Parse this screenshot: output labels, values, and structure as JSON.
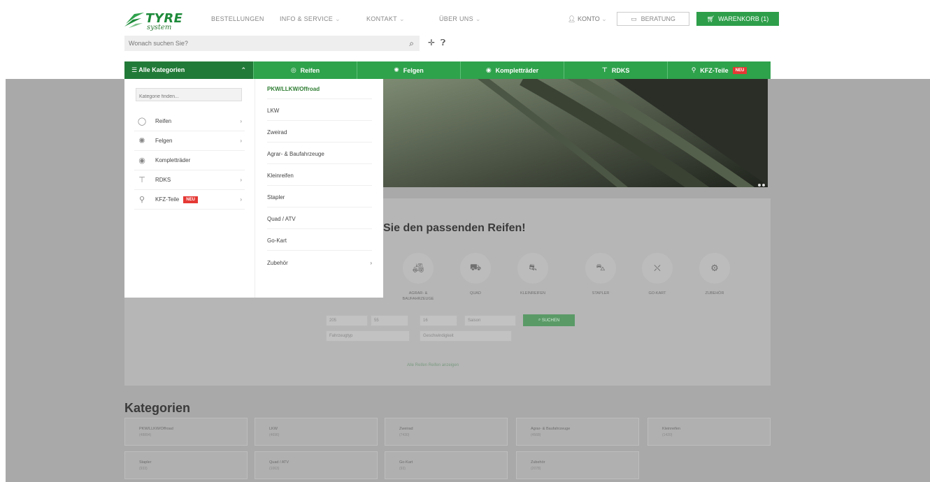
{
  "brand": {
    "name": "TYRE",
    "sub": "system",
    "green": "#2fa24c",
    "dark_green": "#227a38"
  },
  "topnav": [
    {
      "label": "BESTELLUNGEN",
      "chev": false
    },
    {
      "label": "INFO & SERVICE",
      "chev": true
    },
    {
      "label": "KONTAKT",
      "chev": true
    },
    {
      "label": "ÜBER UNS",
      "chev": true
    }
  ],
  "account": {
    "konto": "KONTO",
    "beratung": "BERATUNG",
    "cart": "WARENKORB (1)"
  },
  "search": {
    "placeholder": "Wonach suchen Sie?"
  },
  "greennav": {
    "all": "Alle Kategorien",
    "items": [
      {
        "label": "Reifen",
        "icon": "tire-icon"
      },
      {
        "label": "Felgen",
        "icon": "rim-icon"
      },
      {
        "label": "Kompletträder",
        "icon": "wheel-icon"
      },
      {
        "label": "RDKS",
        "icon": "sensor-icon"
      },
      {
        "label": "KFZ-Teile",
        "icon": "parts-icon",
        "badge": "NEU"
      }
    ]
  },
  "dropdown": {
    "search_placeholder": "Kategorie finden...",
    "left": [
      {
        "label": "Reifen",
        "arrow": true
      },
      {
        "label": "Felgen",
        "arrow": true
      },
      {
        "label": "Kompletträder",
        "arrow": false
      },
      {
        "label": "RDKS",
        "arrow": true
      },
      {
        "label": "KFZ-Teile",
        "arrow": true,
        "badge": "NEU"
      }
    ],
    "right": [
      {
        "label": "PKW/LLKW/Offroad",
        "arrow": false
      },
      {
        "label": "LKW",
        "arrow": false
      },
      {
        "label": "Zweirad",
        "arrow": false
      },
      {
        "label": "Agrar- & Baufahrzeuge",
        "arrow": false
      },
      {
        "label": "Kleinreifen",
        "arrow": false
      },
      {
        "label": "Stapler",
        "arrow": false
      },
      {
        "label": "Quad / ATV",
        "arrow": false
      },
      {
        "label": "Go-Kart",
        "arrow": false
      },
      {
        "label": "Zubehör",
        "arrow": true
      }
    ]
  },
  "finder": {
    "title": "Sie den passenden Reifen!",
    "vehicles": [
      {
        "label": "AGRAR- &\nBAUFAHRZEUGE",
        "icon": "tractor-icon"
      },
      {
        "label": "QUAD",
        "icon": "quad-icon"
      },
      {
        "label": "KLEINREIFEN",
        "icon": "smalltire-icon"
      },
      {
        "label": "STAPLER",
        "icon": "forklift-icon"
      },
      {
        "label": "GO-KART",
        "icon": "gokart-icon"
      },
      {
        "label": "ZUBEHÖR",
        "icon": "accessory-icon"
      }
    ],
    "selects": [
      "205",
      "55",
      "16",
      "Saison"
    ],
    "selects2": [
      "Fahrzeugtyp",
      "Geschwindigkeit"
    ],
    "search_btn": "SUCHEN",
    "link": "Alle Reifen Reifen anzeigen"
  },
  "kategorien": {
    "title": "Kategorien",
    "cards": [
      {
        "title": "PKW/LLKW/Offroad",
        "count": "(48894)"
      },
      {
        "title": "LKW",
        "count": "(4696)"
      },
      {
        "title": "Zweirad",
        "count": "(7430)"
      },
      {
        "title": "Agrar- & Baufahrzeuge",
        "count": "(4568)"
      },
      {
        "title": "Kleinreifen",
        "count": "(1420)"
      },
      {
        "title": "Stapler",
        "count": "(933)"
      },
      {
        "title": "Quad / ATV",
        "count": "(1063)"
      },
      {
        "title": "Go-Kart",
        "count": "(93)"
      },
      {
        "title": "Zubehör",
        "count": "(2078)"
      }
    ]
  }
}
